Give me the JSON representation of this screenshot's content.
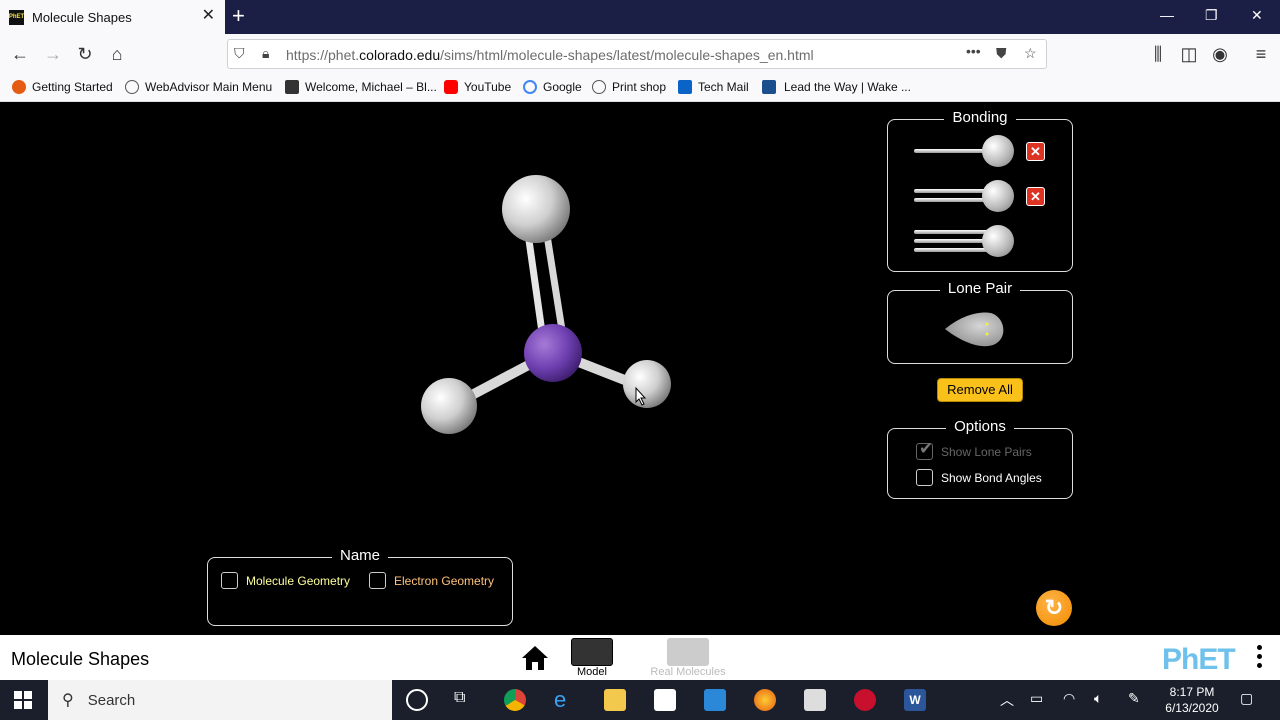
{
  "browser": {
    "tab_title": "Molecule Shapes",
    "url_prefix": "https://phet.",
    "url_domain": "colorado.edu",
    "url_path": "/sims/html/molecule-shapes/latest/molecule-shapes_en.html"
  },
  "bookmarks": [
    {
      "label": "Getting Started",
      "color": "#e55b13"
    },
    {
      "label": "WebAdvisor Main Menu",
      "color": "#555"
    },
    {
      "label": "Welcome, Michael – Bl...",
      "color": "#333"
    },
    {
      "label": "YouTube",
      "color": "#ff0000"
    },
    {
      "label": "Google",
      "color": "#4285f4"
    },
    {
      "label": "Print shop",
      "color": "#555"
    },
    {
      "label": "Tech Mail",
      "color": "#0a64c8"
    },
    {
      "label": "Lead the Way | Wake ...",
      "color": "#1b4e8c"
    }
  ],
  "sim": {
    "bonding_title": "Bonding",
    "lone_pair_title": "Lone Pair",
    "remove_all": "Remove All",
    "options_title": "Options",
    "show_lone_pairs": "Show Lone Pairs",
    "show_bond_angles": "Show Bond Angles",
    "name_title": "Name",
    "molecule_geometry": "Molecule Geometry",
    "electron_geometry": "Electron Geometry"
  },
  "simnav": {
    "title": "Molecule Shapes",
    "screens": [
      "Model",
      "Real Molecules"
    ],
    "logo": "PhET"
  },
  "taskbar": {
    "search_placeholder": "Search",
    "time": "8:17 PM",
    "date": "6/13/2020"
  }
}
